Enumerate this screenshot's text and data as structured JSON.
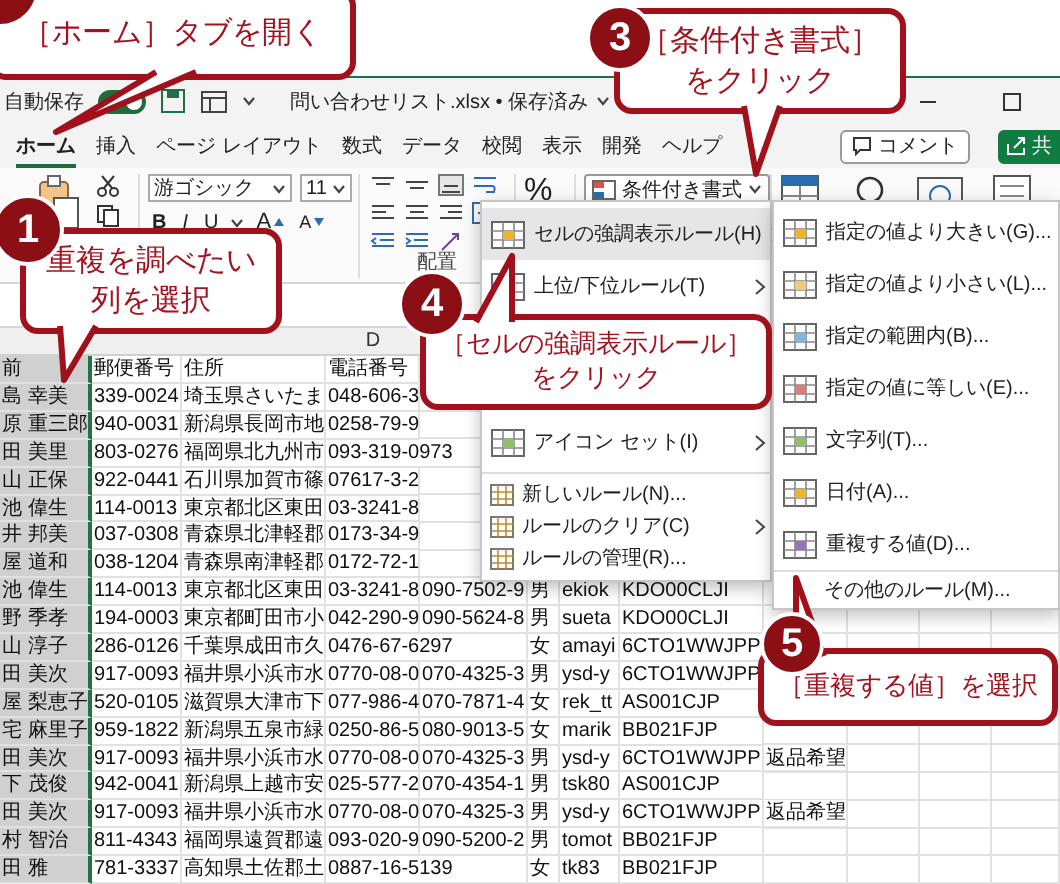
{
  "title_bar": {
    "autosave_label": "自動保存",
    "autosave_on": true,
    "file_name": "問い合わせリスト.xlsx • 保存済み"
  },
  "tabs": [
    {
      "label": "ホーム",
      "selected": true
    },
    {
      "label": "挿入",
      "selected": false
    },
    {
      "label": "ページ レイアウト",
      "selected": false
    },
    {
      "label": "数式",
      "selected": false
    },
    {
      "label": "データ",
      "selected": false
    },
    {
      "label": "校閲",
      "selected": false
    },
    {
      "label": "表示",
      "selected": false
    },
    {
      "label": "開発",
      "selected": false
    },
    {
      "label": "ヘルプ",
      "selected": false
    }
  ],
  "comment_button": "コメント",
  "share_button": "共",
  "ribbon": {
    "font_name": "游ゴシック",
    "font_size": "11",
    "format_buttons": [
      "B",
      "I",
      "U"
    ],
    "font_size_buttons": [
      "A",
      "A"
    ],
    "alignment_group": "配置",
    "percent_button": "%",
    "conditional_formatting_button": "条件付き書式"
  },
  "sheet": {
    "column_letter": "D",
    "columns": [
      {
        "heading": "前",
        "selected": true
      },
      {
        "heading": "郵便番号",
        "selected": false
      },
      {
        "heading": "住所",
        "selected": false
      },
      {
        "heading": "電話番号",
        "selected": false
      }
    ],
    "rows": [
      [
        "島 幸美",
        "339-0024",
        "埼玉県さいたま",
        "048-606-3",
        null,
        null,
        null,
        null,
        null
      ],
      [
        "原 重三郎",
        "940-0031",
        "新潟県長岡市地",
        "0258-79-9",
        null,
        null,
        null,
        null,
        null
      ],
      [
        "田 美里",
        "803-0276",
        "福岡県北九州市",
        "093-319-0973",
        null,
        null,
        null,
        null,
        null
      ],
      [
        "山 正保",
        "922-0441",
        "石川県加賀市篠",
        "07617-3-2",
        null,
        null,
        null,
        null,
        null
      ],
      [
        "池 偉生",
        "114-0013",
        "東京都北区東田",
        "03-3241-8",
        null,
        null,
        null,
        null,
        null
      ],
      [
        "井 邦美",
        "037-0308",
        "青森県北津軽郡",
        "0173-34-9",
        null,
        null,
        null,
        null,
        null
      ],
      [
        "屋 道和",
        "038-1204",
        "青森県南津軽郡",
        "0172-72-1",
        null,
        null,
        null,
        null,
        null
      ],
      [
        "池 偉生",
        "114-0013",
        "東京都北区東田",
        "03-3241-8",
        "090-7502-9",
        "男",
        "ekiok",
        "KDO00CLJI",
        null
      ],
      [
        "野 季孝",
        "194-0003",
        "東京都町田市小",
        "042-290-9",
        "090-5624-8",
        "男",
        "sueta",
        "KDO00CLJI",
        null
      ],
      [
        "山 淳子",
        "286-0126",
        "千葉県成田市久",
        "0476-67-6297",
        null,
        "女",
        "amayi",
        "6CTO1WWJPP",
        null
      ],
      [
        "田 美次",
        "917-0093",
        "福井県小浜市水",
        "0770-08-0",
        "070-4325-3",
        "男",
        "ysd-y",
        "6CTO1WWJPP",
        null
      ],
      [
        "屋 梨恵子",
        "520-0105",
        "滋賀県大津市下",
        "077-986-4",
        "070-7871-4",
        "女",
        "rek_tt",
        "AS001CJP",
        null
      ],
      [
        "宅 麻里子",
        "959-1822",
        "新潟県五泉市緑",
        "0250-86-5",
        "080-9013-5",
        "女",
        "marik",
        "BB021FJP",
        null
      ],
      [
        "田 美次",
        "917-0093",
        "福井県小浜市水",
        "0770-08-0",
        "070-4325-3",
        "男",
        "ysd-y",
        "6CTO1WWJPP",
        "返品希望"
      ],
      [
        "下 茂俊",
        "942-0041",
        "新潟県上越市安",
        "025-577-2",
        "070-4354-1",
        "男",
        "tsk80",
        "AS001CJP",
        null
      ],
      [
        "田 美次",
        "917-0093",
        "福井県小浜市水",
        "0770-08-0",
        "070-4325-3",
        "男",
        "ysd-y",
        "6CTO1WWJPP",
        "返品希望"
      ],
      [
        "村 智治",
        "811-4343",
        "福岡県遠賀郡遠",
        "093-020-9",
        "090-5200-2",
        "男",
        "tomot",
        "BB021FJP",
        null
      ],
      [
        "田 雅",
        "781-3337",
        "高知県土佐郡土",
        "0887-16-5139",
        null,
        "女",
        "tk83",
        "BB021FJP",
        null
      ]
    ]
  },
  "conditional_formatting_menu": {
    "items": [
      {
        "kind": "large",
        "label": "セルの強調表示ルール(H)",
        "submenu": true,
        "highlighted": true
      },
      {
        "kind": "large",
        "label": "上位/下位ルール(T)",
        "submenu": true,
        "highlighted": false
      },
      {
        "kind": "covered"
      },
      {
        "kind": "covered"
      },
      {
        "kind": "large",
        "label": "アイコン セット(I)",
        "submenu": true,
        "highlighted": false
      },
      {
        "kind": "small",
        "label": "新しいルール(N)...",
        "submenu": false,
        "highlighted": false
      },
      {
        "kind": "small",
        "label": "ルールのクリア(C)",
        "submenu": true,
        "highlighted": false
      },
      {
        "kind": "small",
        "label": "ルールの管理(R)...",
        "submenu": false,
        "highlighted": false
      }
    ]
  },
  "rule_submenu": {
    "items": [
      {
        "kind": "large",
        "label": "指定の値より大きい(G)..."
      },
      {
        "kind": "large",
        "label": "指定の値より小さい(L)..."
      },
      {
        "kind": "large",
        "label": "指定の範囲内(B)..."
      },
      {
        "kind": "large",
        "label": "指定の値に等しい(E)..."
      },
      {
        "kind": "large",
        "label": "文字列(T)..."
      },
      {
        "kind": "large",
        "label": "日付(A)..."
      },
      {
        "kind": "large",
        "label": "重複する値(D)..."
      },
      {
        "kind": "footer",
        "label": "その他のルール(M)..."
      }
    ]
  },
  "callouts": [
    {
      "lines": [
        "［ホーム］タブを開く"
      ]
    },
    {
      "number": "1",
      "lines": [
        "重複を調べたい",
        "列を選択"
      ]
    },
    {
      "number": "3",
      "lines": [
        "［条件付き書式］",
        "をクリック"
      ]
    },
    {
      "number": "4",
      "lines": [
        "［セルの強調表示ルール］",
        "をクリック"
      ]
    },
    {
      "number": "5",
      "lines": [
        "［重複する値］を選択"
      ]
    }
  ]
}
